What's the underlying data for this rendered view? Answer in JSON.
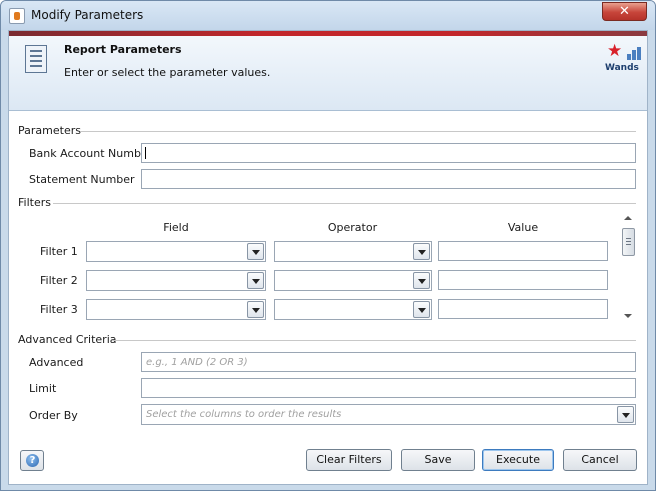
{
  "window": {
    "title": "Modify Parameters",
    "close_glyph": "✕"
  },
  "banner": {
    "title": "Report Parameters",
    "subtitle": "Enter or select the parameter values.",
    "logo_text": "Wands",
    "icon": "document-list-icon",
    "accent_color": "#c2262b"
  },
  "parameters": {
    "label": "Parameters",
    "bank_account_label": "Bank Account Number",
    "bank_account_value": "",
    "statement_label": "Statement Number",
    "statement_value": ""
  },
  "filters": {
    "label": "Filters",
    "columns": [
      "Field",
      "Operator",
      "Value"
    ],
    "rows": [
      {
        "label": "Filter 1",
        "field": "",
        "operator": "",
        "value": ""
      },
      {
        "label": "Filter 2",
        "field": "",
        "operator": "",
        "value": ""
      },
      {
        "label": "Filter 3",
        "field": "",
        "operator": "",
        "value": ""
      }
    ]
  },
  "advanced": {
    "label": "Advanced Criteria",
    "advanced_label": "Advanced",
    "advanced_placeholder": "e.g., 1 AND (2 OR 3)",
    "limit_label": "Limit",
    "limit_value": "",
    "order_by_label": "Order By",
    "order_by_placeholder": "Select the columns to order the results"
  },
  "buttons": {
    "help": "?",
    "clear_filters": "Clear Filters",
    "save": "Save",
    "execute": "Execute",
    "cancel": "Cancel"
  }
}
